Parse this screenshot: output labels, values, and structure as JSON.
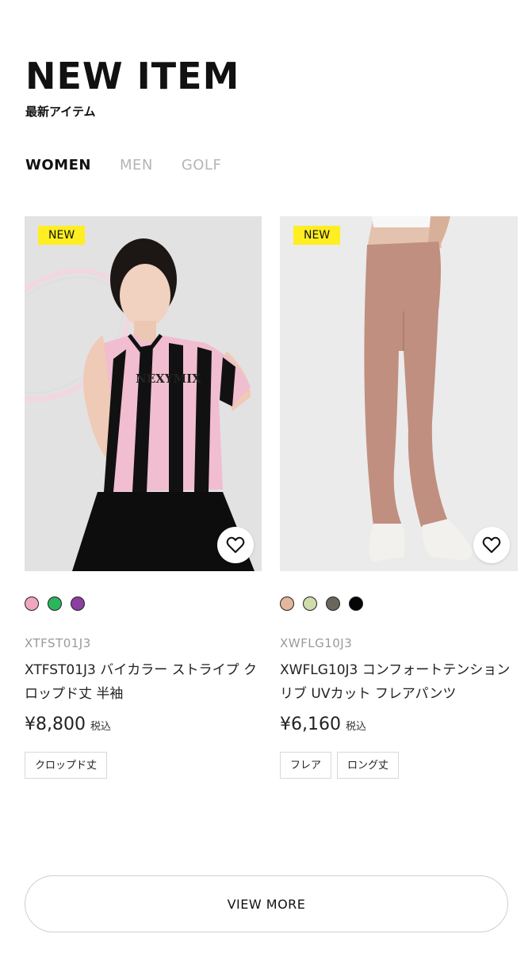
{
  "header": {
    "title": "NEW ITEM",
    "subtitle": "最新アイテム"
  },
  "tabs": [
    {
      "label": "WOMEN",
      "active": true
    },
    {
      "label": "MEN",
      "active": false
    },
    {
      "label": "GOLF",
      "active": false
    }
  ],
  "products": [
    {
      "badge": "NEW",
      "print_text": "NEXYMIX",
      "swatches": [
        "#f2a6be",
        "#2db55d",
        "#8c3fa0"
      ],
      "sku": "XTFST01J3",
      "name_line1": "XTFST01J3 バイカラー ストライプ ク",
      "name_line2": "ロップド丈 半袖",
      "price": "¥8,800",
      "tax_label": "税込",
      "tags": [
        "クロップド丈"
      ],
      "wishlist_icon": "heart-icon"
    },
    {
      "badge": "NEW",
      "swatches": [
        "#e4b69c",
        "#cfdcab",
        "#6a665c",
        "#050505"
      ],
      "sku": "XWFLG10J3",
      "name_line1": "XWFLG10J3 コンフォートテンション",
      "name_line2": "リブ UVカット フレアパンツ",
      "price": "¥6,160",
      "tax_label": "税込",
      "tags": [
        "フレア",
        "ロング丈"
      ],
      "wishlist_icon": "heart-icon"
    }
  ],
  "view_more": "VIEW MORE",
  "colors": {
    "badge": "#ffee22",
    "text": "#111111",
    "muted": "#9a9a9a"
  }
}
